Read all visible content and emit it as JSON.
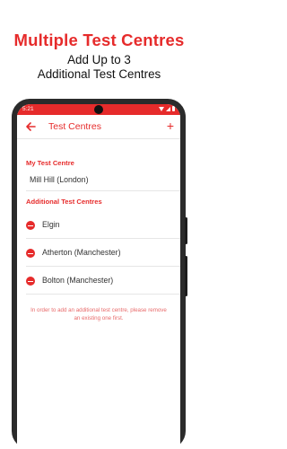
{
  "promo": {
    "title": "Multiple Test Centres",
    "subtitle_line1": "Add Up to 3",
    "subtitle_line2": "Additional Test Centres"
  },
  "status_bar": {
    "time": "5:21"
  },
  "app_bar": {
    "title": "Test Centres",
    "add_label": "+"
  },
  "my_centre": {
    "label": "My Test Centre",
    "value": "Mill Hill (London)"
  },
  "additional": {
    "label": "Additional Test Centres",
    "items": [
      {
        "name": "Elgin"
      },
      {
        "name": "Atherton (Manchester)"
      },
      {
        "name": "Bolton (Manchester)"
      }
    ]
  },
  "notice": "In order to add an additional test centre, please remove an existing one first.",
  "colors": {
    "accent": "#e62b2b",
    "text": "#333333",
    "divider": "#e6e6e6"
  },
  "icons": {
    "back": "arrow-left-icon",
    "add": "plus-icon",
    "remove": "minus-circle-icon"
  }
}
